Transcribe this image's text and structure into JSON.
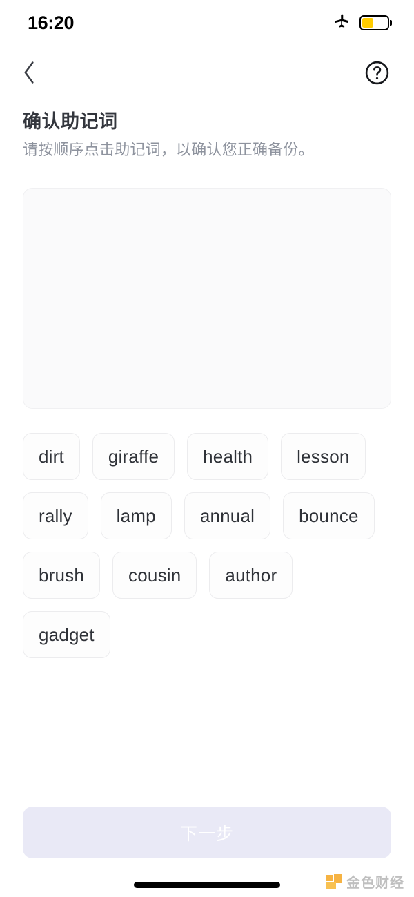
{
  "status_bar": {
    "time": "16:20",
    "airplane_icon": "airplane-mode-icon",
    "battery_icon": "battery-low-power-icon",
    "battery_level_percent": 45,
    "battery_color": "#ffcc00"
  },
  "nav_bar": {
    "back_icon": "chevron-left-icon",
    "help_icon": "question-mark-circle-icon"
  },
  "header": {
    "title": "确认助记词",
    "subtitle": "请按顺序点击助记词，以确认您正确备份。"
  },
  "answer_area": {
    "selected_words": [],
    "background_color": "#fafafb"
  },
  "word_pool": {
    "words": [
      "dirt",
      "giraffe",
      "health",
      "lesson",
      "rally",
      "lamp",
      "annual",
      "bounce",
      "brush",
      "cousin",
      "author",
      "gadget"
    ]
  },
  "footer": {
    "next_label": "下一步",
    "next_enabled": false,
    "next_background_color": "#e9e9f6",
    "next_text_color": "#ffffff"
  },
  "watermark": {
    "text": "金色财经",
    "logo_color": "#f5a623"
  }
}
